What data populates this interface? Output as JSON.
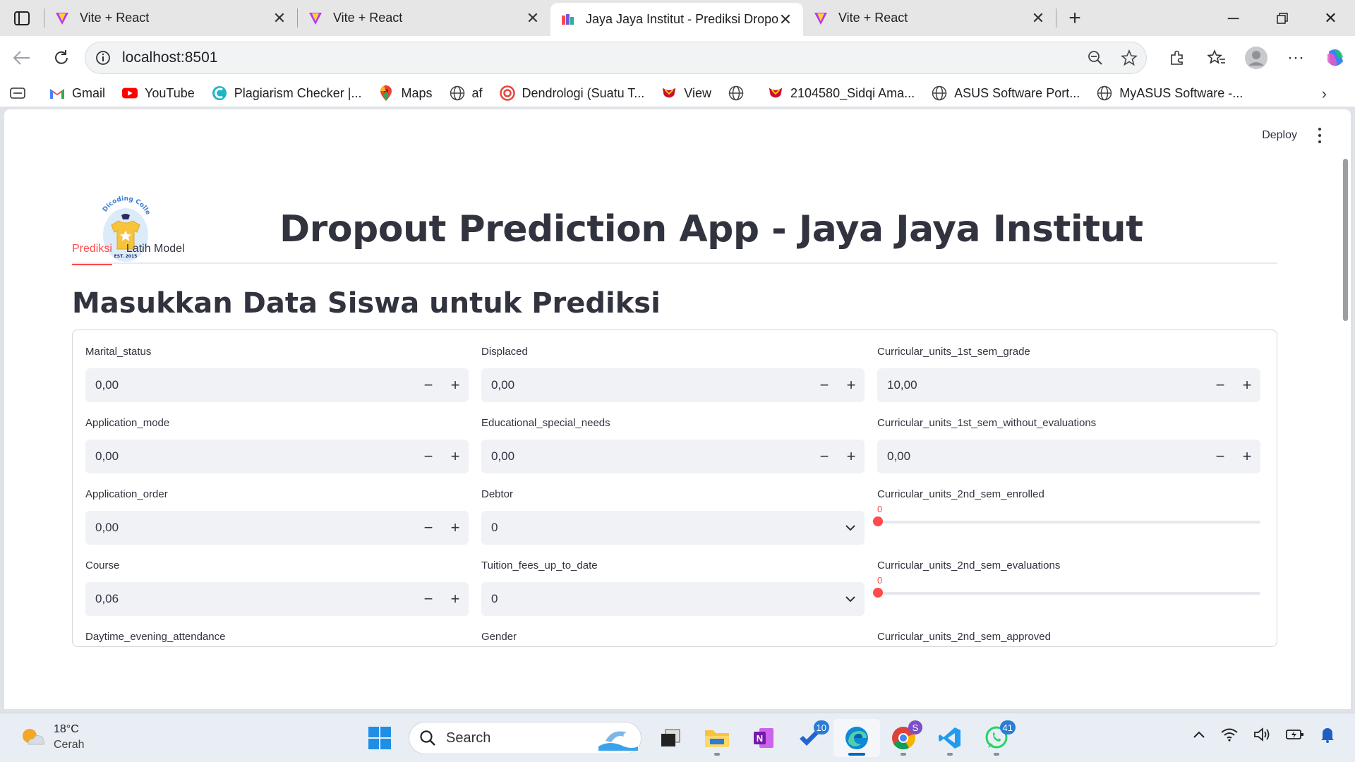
{
  "browser": {
    "tabs": [
      {
        "title": "Vite + React",
        "active": false
      },
      {
        "title": "Vite + React",
        "active": false
      },
      {
        "title": "Jaya Jaya Institut - Prediksi Dropo",
        "active": true
      },
      {
        "title": "Vite + React",
        "active": false
      }
    ],
    "url": "localhost:8501",
    "bookmarks": [
      {
        "label": "Gmail",
        "icon": "gmail-icon"
      },
      {
        "label": "YouTube",
        "icon": "youtube-icon"
      },
      {
        "label": "Plagiarism Checker |...",
        "icon": "plagiarism-icon"
      },
      {
        "label": "Maps",
        "icon": "maps-icon"
      },
      {
        "label": "af",
        "icon": "globe-icon"
      },
      {
        "label": "Dendrologi (Suatu T...",
        "icon": "target-icon"
      },
      {
        "label": "View",
        "icon": "upi-icon"
      },
      {
        "label": "",
        "icon": "globe-icon"
      },
      {
        "label": "2104580_Sidqi Ama...",
        "icon": "upi-icon"
      },
      {
        "label": "ASUS Software Port...",
        "icon": "globe-icon"
      },
      {
        "label": "MyASUS Software -...",
        "icon": "globe-icon"
      }
    ]
  },
  "app": {
    "deploy_label": "Deploy",
    "logo_text": "Dicoding Collection",
    "logo_est": "EST. 2015",
    "title": "Dropout Prediction App - Jaya Jaya Institut",
    "tabs": [
      {
        "label": "Prediksi",
        "active": true
      },
      {
        "label": "Latih Model",
        "active": false
      }
    ],
    "section_title": "Masukkan Data Siswa untuk Prediksi",
    "fields": {
      "marital_status": {
        "label": "Marital_status",
        "value": "0,00"
      },
      "application_mode": {
        "label": "Application_mode",
        "value": "0,00"
      },
      "application_order": {
        "label": "Application_order",
        "value": "0,00"
      },
      "course": {
        "label": "Course",
        "value": "0,06"
      },
      "daytime": {
        "label": "Daytime_evening_attendance"
      },
      "displaced": {
        "label": "Displaced",
        "value": "0,00"
      },
      "edu_special": {
        "label": "Educational_special_needs",
        "value": "0,00"
      },
      "debtor": {
        "label": "Debtor",
        "value": "0"
      },
      "tuition": {
        "label": "Tuition_fees_up_to_date",
        "value": "0"
      },
      "gender": {
        "label": "Gender"
      },
      "cu1_grade": {
        "label": "Curricular_units_1st_sem_grade",
        "value": "10,00"
      },
      "cu1_without_eval": {
        "label": "Curricular_units_1st_sem_without_evaluations",
        "value": "0,00"
      },
      "cu2_enrolled": {
        "label": "Curricular_units_2nd_sem_enrolled",
        "value": "0",
        "fraction": 0
      },
      "cu2_evaluations": {
        "label": "Curricular_units_2nd_sem_evaluations",
        "value": "0",
        "fraction": 0
      },
      "cu2_approved": {
        "label": "Curricular_units_2nd_sem_approved"
      }
    },
    "minus": "−",
    "plus": "+",
    "accent_color": "#ff4b4b"
  },
  "taskbar": {
    "temperature": "18°C",
    "weather": "Cerah",
    "search_placeholder": "Search",
    "badges": {
      "todo": "10",
      "whatsapp": "41",
      "chrome_profile": "S"
    }
  }
}
